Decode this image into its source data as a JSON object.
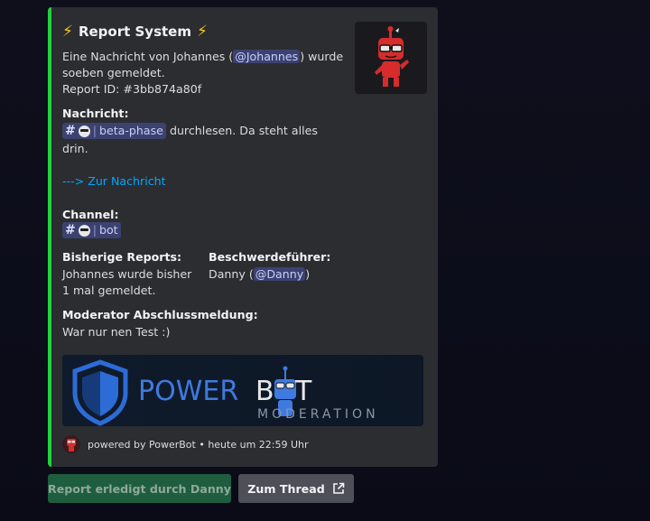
{
  "embed": {
    "title": "Report System",
    "accent_color": "#23d140",
    "desc_line1_pre": "Eine Nachricht von Johannes (",
    "desc_line1_mention": "@Johannes",
    "desc_line1_post": ") wurde",
    "desc_line2": "soeben gemeldet.",
    "desc_line3": "Report ID: #3bb874a80f",
    "fields": {
      "message_name": "Nachricht:",
      "message_channel_hash": "#",
      "message_channel_bar": "|",
      "message_channel_name": "beta-phase",
      "message_text_1": "durchlesen. Da steht alles",
      "message_text_2": "drin.",
      "message_link": "---> Zur Nachricht",
      "channel_name": "Channel:",
      "channel_hash": "#",
      "channel_bar": "|",
      "channel_value": "bot",
      "reports_name": "Bisherige Reports:",
      "reports_line1": "Johannes wurde bisher",
      "reports_line2": "1 mal gemeldet.",
      "complainant_name": "Beschwerdeführer:",
      "complainant_pre": "Danny (",
      "complainant_mention": "@Danny",
      "complainant_post": ")",
      "moderator_name": "Moderator Abschlussmeldung:",
      "moderator_value": "War nur nen Test :)"
    },
    "banner": {
      "word1": "POWER",
      "word2_b": "B",
      "word2_t": "T",
      "sub": "MODERATION"
    },
    "footer": {
      "text": "powered by PowerBot • heute um 22:59 Uhr"
    }
  },
  "buttons": {
    "done_label": "Report erledigt durch Danny",
    "thread_label": "Zum Thread"
  }
}
